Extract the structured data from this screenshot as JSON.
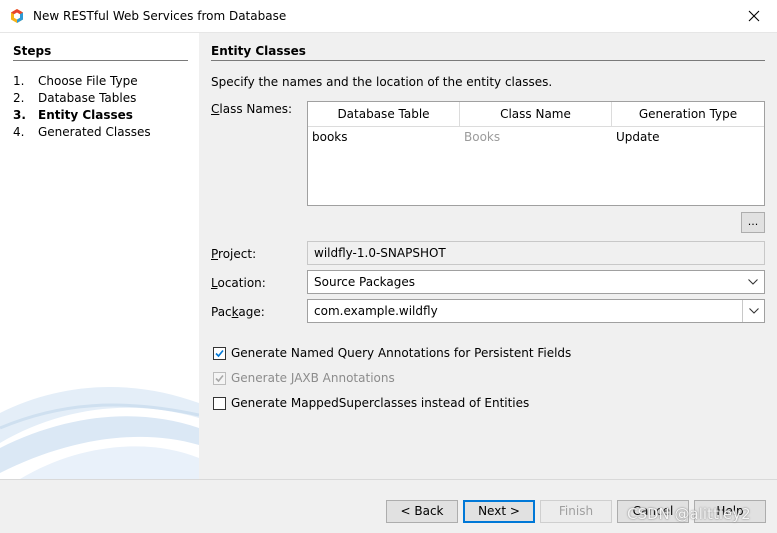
{
  "window": {
    "title": "New RESTful Web Services from Database",
    "close_glyph": "✕"
  },
  "steps": {
    "title": "Steps",
    "items": [
      {
        "num": "1.",
        "label": "Choose File Type"
      },
      {
        "num": "2.",
        "label": "Database Tables"
      },
      {
        "num": "3.",
        "label": "Entity Classes"
      },
      {
        "num": "4.",
        "label": "Generated Classes"
      }
    ],
    "current_index": 2
  },
  "panel": {
    "title": "Entity Classes",
    "description": "Specify the names and the location of the entity classes.",
    "class_names_label_pre": "",
    "class_names_label_mnemonic": "C",
    "class_names_label_post": "lass Names:",
    "table": {
      "columns": [
        "Database Table",
        "Class Name",
        "Generation Type"
      ],
      "rows": [
        {
          "table": "books",
          "class": "Books",
          "generation": "Update"
        }
      ]
    },
    "ellipsis_label": "...",
    "project_label_pre": "",
    "project_label_mnemonic": "P",
    "project_label_post": "roject:",
    "project_value": "wildfly-1.0-SNAPSHOT",
    "location_label_pre": "",
    "location_label_mnemonic": "L",
    "location_label_post": "ocation:",
    "location_value": "Source Packages",
    "package_label_pre": "Pac",
    "package_label_mnemonic": "k",
    "package_label_post": "age:",
    "package_value": "com.example.wildfly",
    "options": [
      {
        "label": "Generate Named Query Annotations for Persistent Fields",
        "checked": true,
        "disabled": false
      },
      {
        "label": "Generate JAXB Annotations",
        "checked": true,
        "disabled": true
      },
      {
        "label": "Generate MappedSuperclasses instead of Entities",
        "checked": false,
        "disabled": false
      }
    ]
  },
  "footer": {
    "back": "< Back",
    "next": "Next >",
    "finish": "Finish",
    "cancel": "Cancel",
    "help": "Help",
    "watermark": "CSDN @alittley2"
  },
  "colors": {
    "accent": "#0078d7",
    "panel_bg": "#f0f0f0"
  }
}
